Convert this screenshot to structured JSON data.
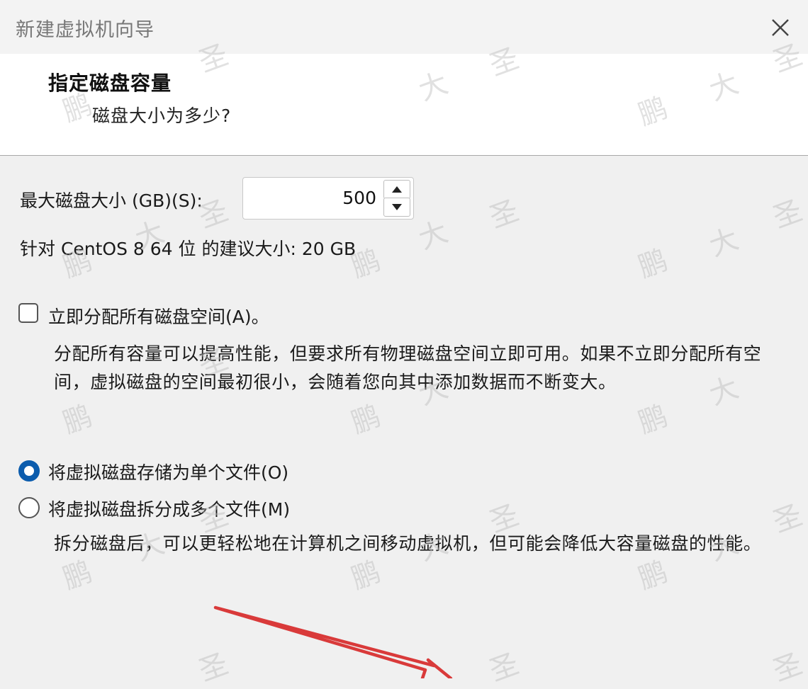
{
  "window": {
    "title": "新建虚拟机向导",
    "close_icon": "close-icon"
  },
  "header": {
    "title": "指定磁盘容量",
    "subtitle": "磁盘大小为多少?"
  },
  "disk_size": {
    "label": "最大磁盘大小 (GB)(S):",
    "value": "500",
    "recommendation": "针对 CentOS 8 64 位 的建议大小: 20 GB"
  },
  "allocate": {
    "label": "立即分配所有磁盘空间(A)。",
    "checked": false,
    "description": "分配所有容量可以提高性能，但要求所有物理磁盘空间立即可用。如果不立即分配所有空间，虚拟磁盘的空间最初很小，会随着您向其中添加数据而不断变大。"
  },
  "storage": {
    "single_file_label": "将虚拟磁盘存储为单个文件(O)",
    "single_file_selected": true,
    "multi_file_label": "将虚拟磁盘拆分成多个文件(M)",
    "multi_file_selected": false,
    "multi_file_description": "拆分磁盘后，可以更轻松地在计算机之间移动虚拟机，但可能会降低大容量磁盘的性能。"
  },
  "watermark": {
    "chars": [
      "圣",
      "大",
      "鹏"
    ]
  },
  "colors": {
    "accent": "#0b5cad",
    "arrow": "#d93a3a"
  }
}
